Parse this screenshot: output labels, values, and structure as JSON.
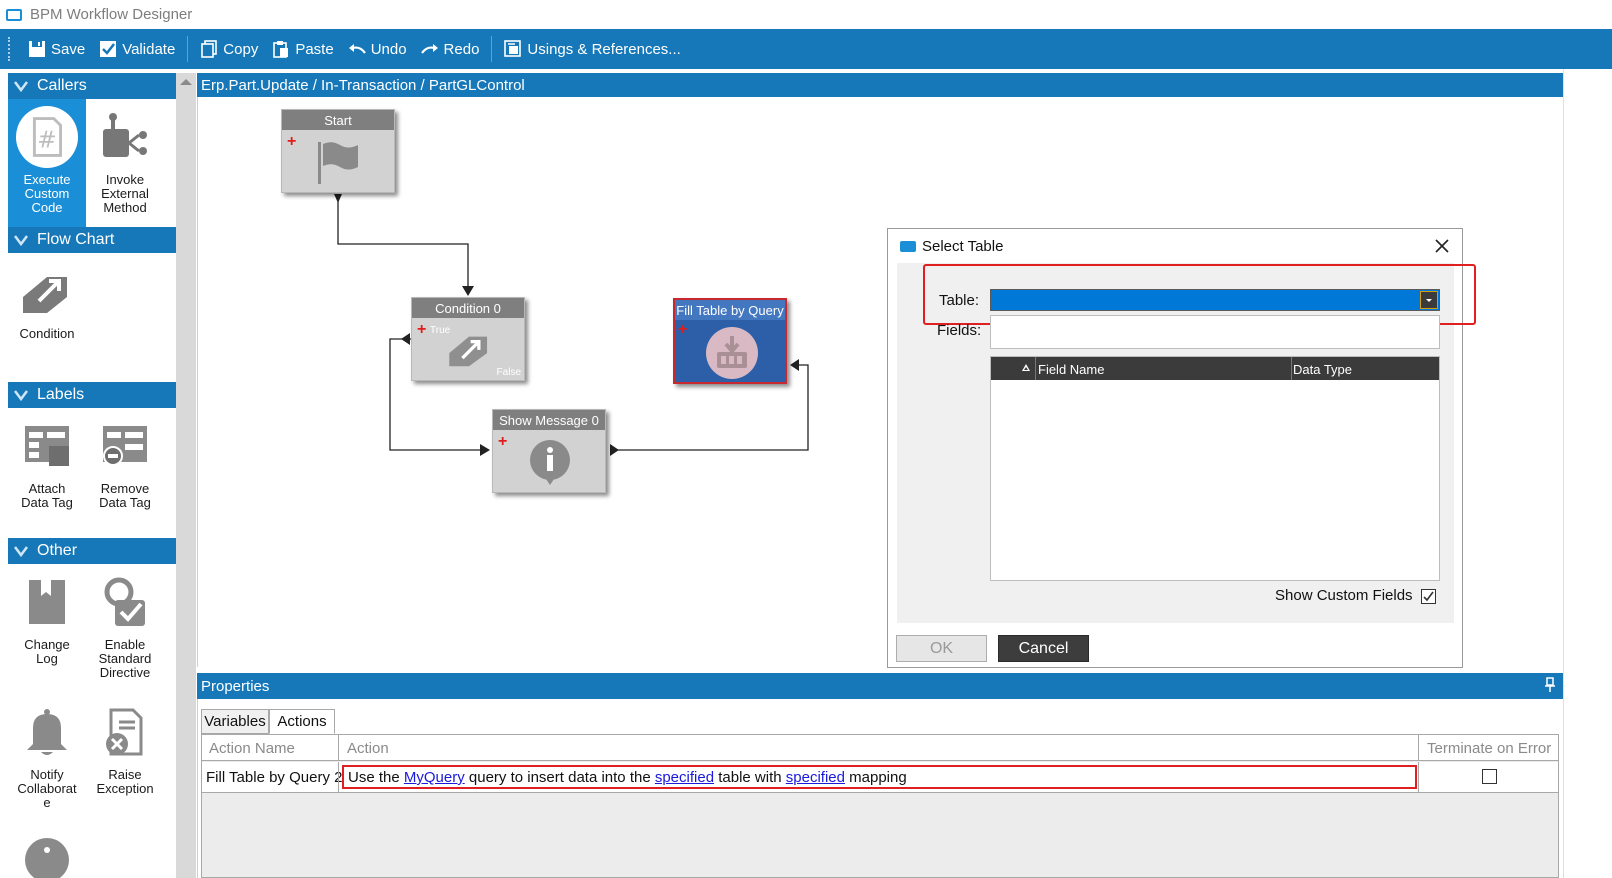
{
  "window": {
    "title": "BPM Workflow Designer"
  },
  "toolbar": {
    "save": "Save",
    "validate": "Validate",
    "copy": "Copy",
    "paste": "Paste",
    "undo": "Undo",
    "redo": "Redo",
    "usings": "Usings & References..."
  },
  "toolbox": {
    "groups": [
      {
        "title": "Callers",
        "items": [
          {
            "label_lines": [
              "Execute",
              "Custom",
              "Code"
            ],
            "icon": "hash-document-icon"
          },
          {
            "label_lines": [
              "Invoke",
              "External",
              "Method"
            ],
            "icon": "external-method-icon"
          }
        ]
      },
      {
        "title": "Flow Chart",
        "items": [
          {
            "label_lines": [
              "Condition"
            ],
            "icon": "condition-icon"
          }
        ]
      },
      {
        "title": "Labels",
        "items": [
          {
            "label_lines": [
              "Attach",
              "Data Tag"
            ],
            "icon": "attach-tag-icon"
          },
          {
            "label_lines": [
              "Remove",
              "Data Tag"
            ],
            "icon": "remove-tag-icon"
          }
        ]
      },
      {
        "title": "Other",
        "items": [
          {
            "label_lines": [
              "Change",
              "Log"
            ],
            "icon": "bookmark-icon"
          },
          {
            "label_lines": [
              "Enable",
              "Standard",
              "Directive"
            ],
            "icon": "directive-icon"
          },
          {
            "label_lines": [
              "Notify",
              "Collaborat",
              "e"
            ],
            "icon": "bell-icon"
          },
          {
            "label_lines": [
              "Raise",
              "Exception"
            ],
            "icon": "exception-icon"
          }
        ]
      }
    ]
  },
  "canvas": {
    "breadcrumb": "Erp.Part.Update / In-Transaction / PartGLControl",
    "nodes": {
      "start": {
        "title": "Start"
      },
      "condition": {
        "title": "Condition 0",
        "true_label": "True",
        "false_label": "False"
      },
      "fill": {
        "title": "Fill Table by Query"
      },
      "message": {
        "title": "Show Message 0"
      }
    }
  },
  "dialog": {
    "title": "Select Table",
    "table_label": "Table:",
    "fields_label": "Fields:",
    "columns": [
      "Field Name",
      "Data Type"
    ],
    "show_custom_fields": "Show Custom Fields",
    "show_custom_checked": true,
    "ok": "OK",
    "cancel": "Cancel"
  },
  "properties": {
    "title": "Properties",
    "tabs": [
      "Variables",
      "Actions"
    ],
    "active_tab": "Actions",
    "columns": {
      "action_name": "Action Name",
      "action": "Action",
      "terminate": "Terminate on Error"
    },
    "rows": [
      {
        "action_name": "Fill Table by Query 2",
        "parts": [
          "Use the ",
          "MyQuery",
          " query to insert data into the ",
          "specified",
          " table with ",
          "specified",
          " mapping"
        ],
        "terminate": false
      }
    ]
  },
  "colors": {
    "accent": "#1678b8",
    "selected": "#1a8fd8",
    "highlight": "#e02020"
  }
}
